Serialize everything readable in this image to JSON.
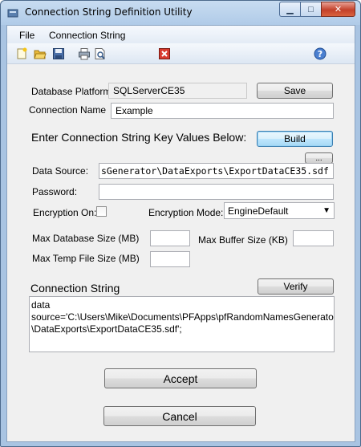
{
  "window": {
    "title": "Connection String Definition Utility",
    "caption_buttons": {
      "minimize": "▁",
      "maximize": "□",
      "close": "✕"
    }
  },
  "menu": {
    "items": [
      "File",
      "Connection String"
    ]
  },
  "toolbar": {
    "icons": [
      "new-file-icon",
      "open-folder-icon",
      "save-disk-icon",
      "print-icon",
      "print-preview-icon",
      "exit-icon",
      "help-icon"
    ]
  },
  "form": {
    "database_platform_label": "Database Platform",
    "database_platform_value": "SQLServerCE35",
    "save_label": "Save",
    "connection_name_label": "Connection Name",
    "connection_name_value": "Example",
    "enter_keys_label": "Enter Connection String Key Values Below:",
    "build_label": "Build",
    "browse_label": "...",
    "data_source_label": "Data Source:",
    "data_source_value": "sGenerator\\DataExports\\ExportDataCE35.sdf",
    "password_label": "Password:",
    "password_value": "",
    "encryption_on_label": "Encryption On:",
    "encryption_mode_label": "Encryption Mode:",
    "encryption_mode_value": "EngineDefault",
    "max_db_size_label": "Max Database Size (MB)",
    "max_db_size_value": "",
    "max_buffer_size_label": "Max Buffer Size (KB)",
    "max_buffer_size_value": "",
    "max_temp_file_label": "Max Temp File Size (MB)",
    "max_temp_file_value": "",
    "connection_string_label": "Connection String",
    "verify_label": "Verify",
    "connection_string_line1": "data source='C:\\Users\\Mike\\Documents\\PFApps\\pfRandomNamesGenerator",
    "connection_string_line2": "\\DataExports\\ExportDataCE35.sdf';",
    "accept_label": "Accept",
    "cancel_label": "Cancel"
  }
}
